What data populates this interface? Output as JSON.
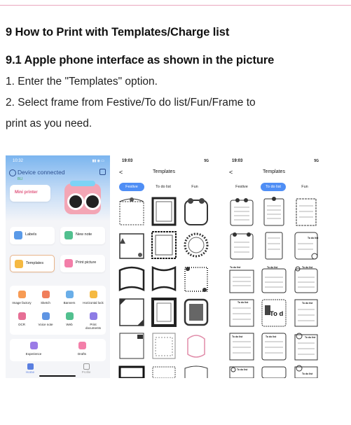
{
  "doc": {
    "heading_1": "9 How to Print with Templates/Charge list",
    "heading_2": "9.1 Apple phone interface as shown in the picture",
    "step_1": "1. Enter the \"Templates\" option.",
    "step_2_line1": "2. Select frame from Festive/To do list/Fun/Frame to",
    "step_2_line2": "print as you need."
  },
  "phone1": {
    "time": "10:32",
    "status": "▮▮ ◉ ▭",
    "device_status": "Device connected",
    "device_model": "BLI",
    "printer_name": "Mini printer",
    "actions": [
      {
        "label": "Labels"
      },
      {
        "label": "New note"
      },
      {
        "label": "Templates"
      },
      {
        "label": "Print picture"
      }
    ],
    "tools": [
      {
        "label": "Image factory"
      },
      {
        "label": "Sketch"
      },
      {
        "label": "Banners"
      },
      {
        "label": "Horizontal lock"
      },
      {
        "label": "OCR"
      },
      {
        "label": "Voice note"
      },
      {
        "label": "Web"
      },
      {
        "label": "Print",
        "label2": "documents"
      }
    ],
    "extras": [
      {
        "label": "Experience"
      },
      {
        "label": "Drafts"
      }
    ],
    "tabbar": [
      {
        "label": "Home"
      },
      {
        "label": "Profile"
      }
    ]
  },
  "phone2": {
    "time": "19:03",
    "status": "5G",
    "back": "<",
    "title": "Templates",
    "tabs": [
      "Festive",
      "To do list",
      "Fun"
    ],
    "active_tab": "Festive"
  },
  "phone3": {
    "time": "19:03",
    "status": "5G",
    "back": "<",
    "title": "Templates",
    "tabs": [
      "Festive",
      "To do list",
      "Fun"
    ],
    "active_tab": "To do list",
    "todo_label": "To do list",
    "big_todo": "To d"
  },
  "colors": {
    "rule": "#e9a7bd",
    "active_tab": "#4f8ef5",
    "header_blue": "#7bb5ef",
    "printer_pink": "#f3a6b5"
  }
}
